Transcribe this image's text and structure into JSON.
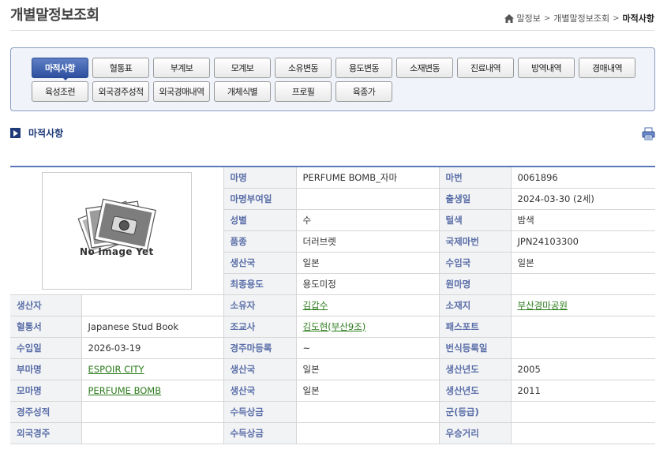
{
  "page": {
    "title": "개별말정보조회"
  },
  "breadcrumb": {
    "home_icon": "home-icon",
    "items": [
      "말정보",
      "개별말정보조회"
    ],
    "current": "마적사항",
    "separator": ">"
  },
  "tabs": {
    "row1": [
      "마적사항",
      "혈통표",
      "부계보",
      "모계보",
      "소유변동",
      "용도변동",
      "소재변동",
      "진료내역",
      "방역내역",
      "경매내역"
    ],
    "row2": [
      "육성조련",
      "외국경주성적",
      "외국경매내역",
      "개체식별",
      "프로필",
      "육종가"
    ],
    "active": "마적사항",
    "colors": {
      "active_bg": "#2d4f9e",
      "border": "#8b9dc3"
    }
  },
  "section": {
    "title": "마적사항",
    "print_icon": "print-icon",
    "arrow_icon": "arrow-right-icon"
  },
  "photo": {
    "caption": "No Image Yet"
  },
  "labels": {
    "name": "마명",
    "horse_no": "마번",
    "name_date": "마명부여일",
    "birth": "출생일",
    "sex": "성별",
    "coat": "털색",
    "breed": "품종",
    "intl_no": "국제마번",
    "origin": "생산국",
    "import_country": "수입국",
    "final_use": "최종용도",
    "original_name": "원마명",
    "producer": "생산자",
    "owner": "소유자",
    "location": "소재지",
    "studbook": "혈통서",
    "trainer": "조교사",
    "passport": "패스포트",
    "import_date": "수입일",
    "race_reg": "경주마등록",
    "breeding_reg": "번식등록일",
    "sire": "부마명",
    "sire_country": "생산국",
    "sire_year": "생산년도",
    "dam": "모마명",
    "dam_country": "생산국",
    "dam_year": "생산년도",
    "race_record": "경주성적",
    "prize1": "수득상금",
    "grade": "군(등급)",
    "foreign_race": "외국경주",
    "prize2": "수득상금",
    "best_distance": "우승거리"
  },
  "values": {
    "name": "PERFUME BOMB_자마",
    "horse_no": "0061896",
    "name_date": "",
    "birth": "2024-03-30 (2세)",
    "sex": "수",
    "coat": "밤색",
    "breed": "더러브렛",
    "intl_no": "JPN24103300",
    "origin": "일본",
    "import_country": "일본",
    "final_use": "용도미정",
    "original_name": "",
    "producer": "",
    "owner": "김갑수",
    "location": "부산경마공원",
    "studbook": "Japanese Stud Book",
    "trainer": "김도현(부산9조)",
    "passport": "",
    "import_date": "2026-03-19",
    "race_reg": "~",
    "breeding_reg": "",
    "sire": "ESPOIR CITY",
    "sire_country": "일본",
    "sire_year": "2005",
    "dam": "PERFUME BOMB",
    "dam_country": "일본",
    "dam_year": "2011",
    "race_record": "",
    "prize1": "",
    "grade": "",
    "foreign_race": "",
    "prize2": "",
    "best_distance": ""
  },
  "colors": {
    "label_text": "#5a6ea8",
    "link": "#2a7a1a",
    "header_rule": "#5a77b8"
  }
}
